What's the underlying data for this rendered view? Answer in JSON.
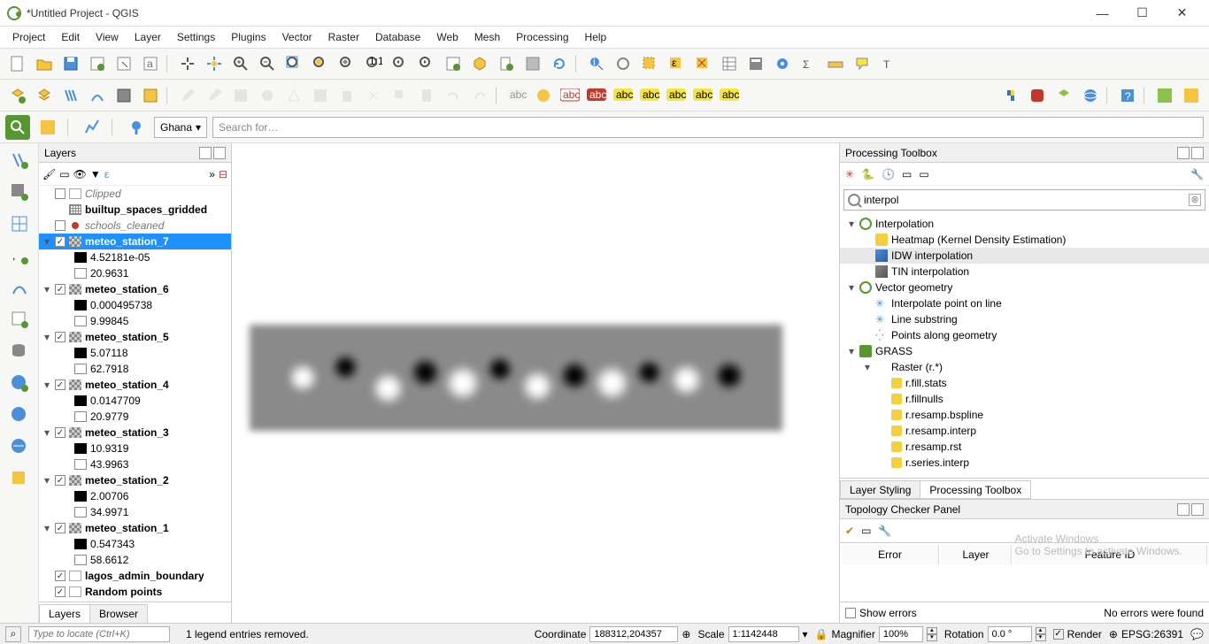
{
  "window": {
    "title": "*Untitled Project - QGIS"
  },
  "menu": [
    "Project",
    "Edit",
    "View",
    "Layer",
    "Settings",
    "Plugins",
    "Vector",
    "Raster",
    "Database",
    "Web",
    "Mesh",
    "Processing",
    "Help"
  ],
  "quickbar": {
    "location": "Ghana",
    "search_placeholder": "Search for…"
  },
  "layers_panel": {
    "title": "Layers",
    "tabs": [
      "Layers",
      "Browser"
    ],
    "active_tab": "Layers",
    "tree": [
      {
        "type": "group",
        "checked": false,
        "style": "empty",
        "label": "Clipped",
        "italic": true
      },
      {
        "type": "layer",
        "style": "grid",
        "label": "builtup_spaces_gridded",
        "bold": true
      },
      {
        "type": "layer",
        "checked": false,
        "style": "dot",
        "label": "schools_cleaned",
        "italic": true
      },
      {
        "type": "raster",
        "expanded": true,
        "checked": true,
        "label": "meteo_station_7",
        "bold": true,
        "selected": true,
        "vals": [
          "4.52181e-05",
          "20.9631"
        ]
      },
      {
        "type": "raster",
        "expanded": true,
        "checked": true,
        "label": "meteo_station_6",
        "bold": true,
        "vals": [
          "0.000495738",
          "9.99845"
        ]
      },
      {
        "type": "raster",
        "expanded": true,
        "checked": true,
        "label": "meteo_station_5",
        "bold": true,
        "vals": [
          "5.07118",
          "62.7918"
        ]
      },
      {
        "type": "raster",
        "expanded": true,
        "checked": true,
        "label": "meteo_station_4",
        "bold": true,
        "vals": [
          "0.0147709",
          "20.9779"
        ]
      },
      {
        "type": "raster",
        "expanded": true,
        "checked": true,
        "label": "meteo_station_3",
        "bold": true,
        "vals": [
          "10.9319",
          "43.9963"
        ]
      },
      {
        "type": "raster",
        "expanded": true,
        "checked": true,
        "label": "meteo_station_2",
        "bold": true,
        "vals": [
          "2.00706",
          "34.9971"
        ]
      },
      {
        "type": "raster",
        "expanded": true,
        "checked": true,
        "label": "meteo_station_1",
        "bold": true,
        "vals": [
          "0.547343",
          "58.6612"
        ]
      },
      {
        "type": "layer",
        "checked": true,
        "style": "empty",
        "label": "lagos_admin_boundary",
        "bold": true
      },
      {
        "type": "layer",
        "checked": true,
        "style": "empty",
        "label": "Random points",
        "bold": true
      }
    ]
  },
  "processing": {
    "title": "Processing Toolbox",
    "search": "interpol",
    "tree": [
      {
        "exp": "▾",
        "icon": "q",
        "label": "Interpolation",
        "indent": 0
      },
      {
        "icon": "heat",
        "label": "Heatmap (Kernel Density Estimation)",
        "indent": 1
      },
      {
        "icon": "idw",
        "label": "IDW interpolation",
        "indent": 1,
        "selected": true
      },
      {
        "icon": "tin",
        "label": "TIN interpolation",
        "indent": 1
      },
      {
        "exp": "▾",
        "icon": "q",
        "label": "Vector geometry",
        "indent": 0
      },
      {
        "icon": "gear",
        "label": "Interpolate point on line",
        "indent": 1,
        "glyph": "✳"
      },
      {
        "icon": "gear",
        "label": "Line substring",
        "indent": 1,
        "glyph": "✳"
      },
      {
        "icon": "gear",
        "label": "Points along geometry",
        "indent": 1,
        "glyph": "⁛"
      },
      {
        "exp": "▾",
        "icon": "grass",
        "label": "GRASS",
        "indent": 0
      },
      {
        "exp": "▾",
        "label": "Raster (r.*)",
        "indent": 1
      },
      {
        "icon": "gr",
        "label": "r.fill.stats",
        "indent": 2
      },
      {
        "icon": "gr",
        "label": "r.fillnulls",
        "indent": 2
      },
      {
        "icon": "gr",
        "label": "r.resamp.bspline",
        "indent": 2
      },
      {
        "icon": "gr",
        "label": "r.resamp.interp",
        "indent": 2
      },
      {
        "icon": "gr",
        "label": "r.resamp.rst",
        "indent": 2
      },
      {
        "icon": "gr",
        "label": "r.series.interp",
        "indent": 2
      }
    ],
    "tabs": [
      "Layer Styling",
      "Processing Toolbox"
    ],
    "active_tab": "Processing Toolbox"
  },
  "topology": {
    "title": "Topology Checker Panel",
    "columns": [
      "Error",
      "Layer",
      "Feature ID"
    ],
    "show_errors_label": "Show errors",
    "footer": "No errors were found"
  },
  "status": {
    "locate_placeholder": "Type to locate (Ctrl+K)",
    "message": "1 legend entries removed.",
    "coord_label": "Coordinate",
    "coord": "188312,204357",
    "scale_label": "Scale",
    "scale": "1:1142448",
    "magnifier_label": "Magnifier",
    "magnifier": "100%",
    "rotation_label": "Rotation",
    "rotation": "0.0 °",
    "render_label": "Render",
    "crs": "EPSG:26391"
  },
  "watermark": {
    "title": "Activate Windows",
    "sub": "Go to Settings to activate Windows."
  }
}
